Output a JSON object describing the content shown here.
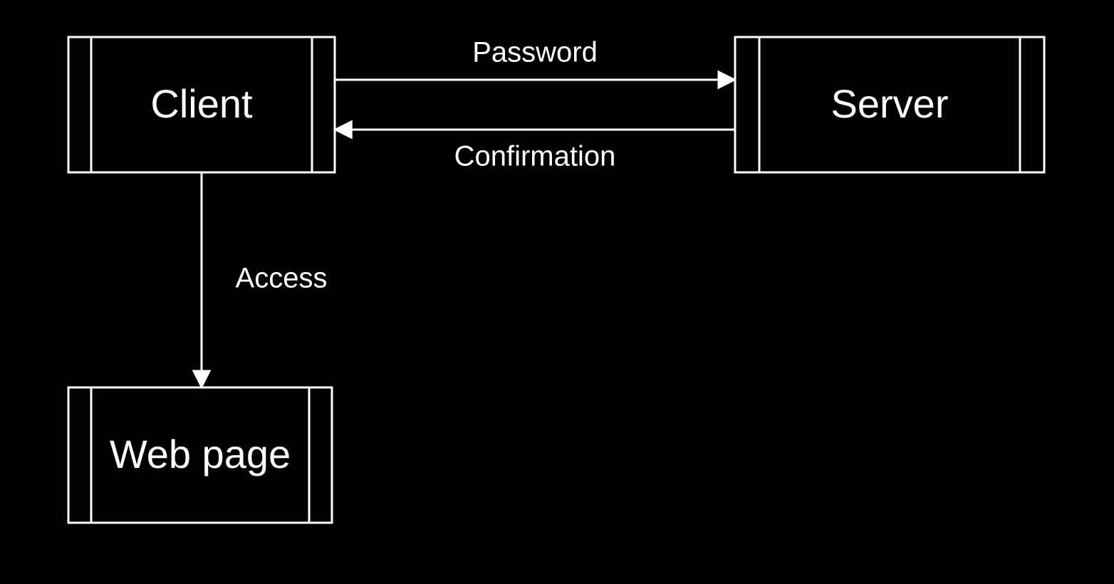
{
  "nodes": {
    "client": {
      "label": "Client"
    },
    "server": {
      "label": "Server"
    },
    "webpage": {
      "label": "Web page"
    }
  },
  "edges": {
    "password": {
      "label": "Password"
    },
    "confirmation": {
      "label": "Confirmation"
    },
    "access": {
      "label": "Access"
    }
  }
}
